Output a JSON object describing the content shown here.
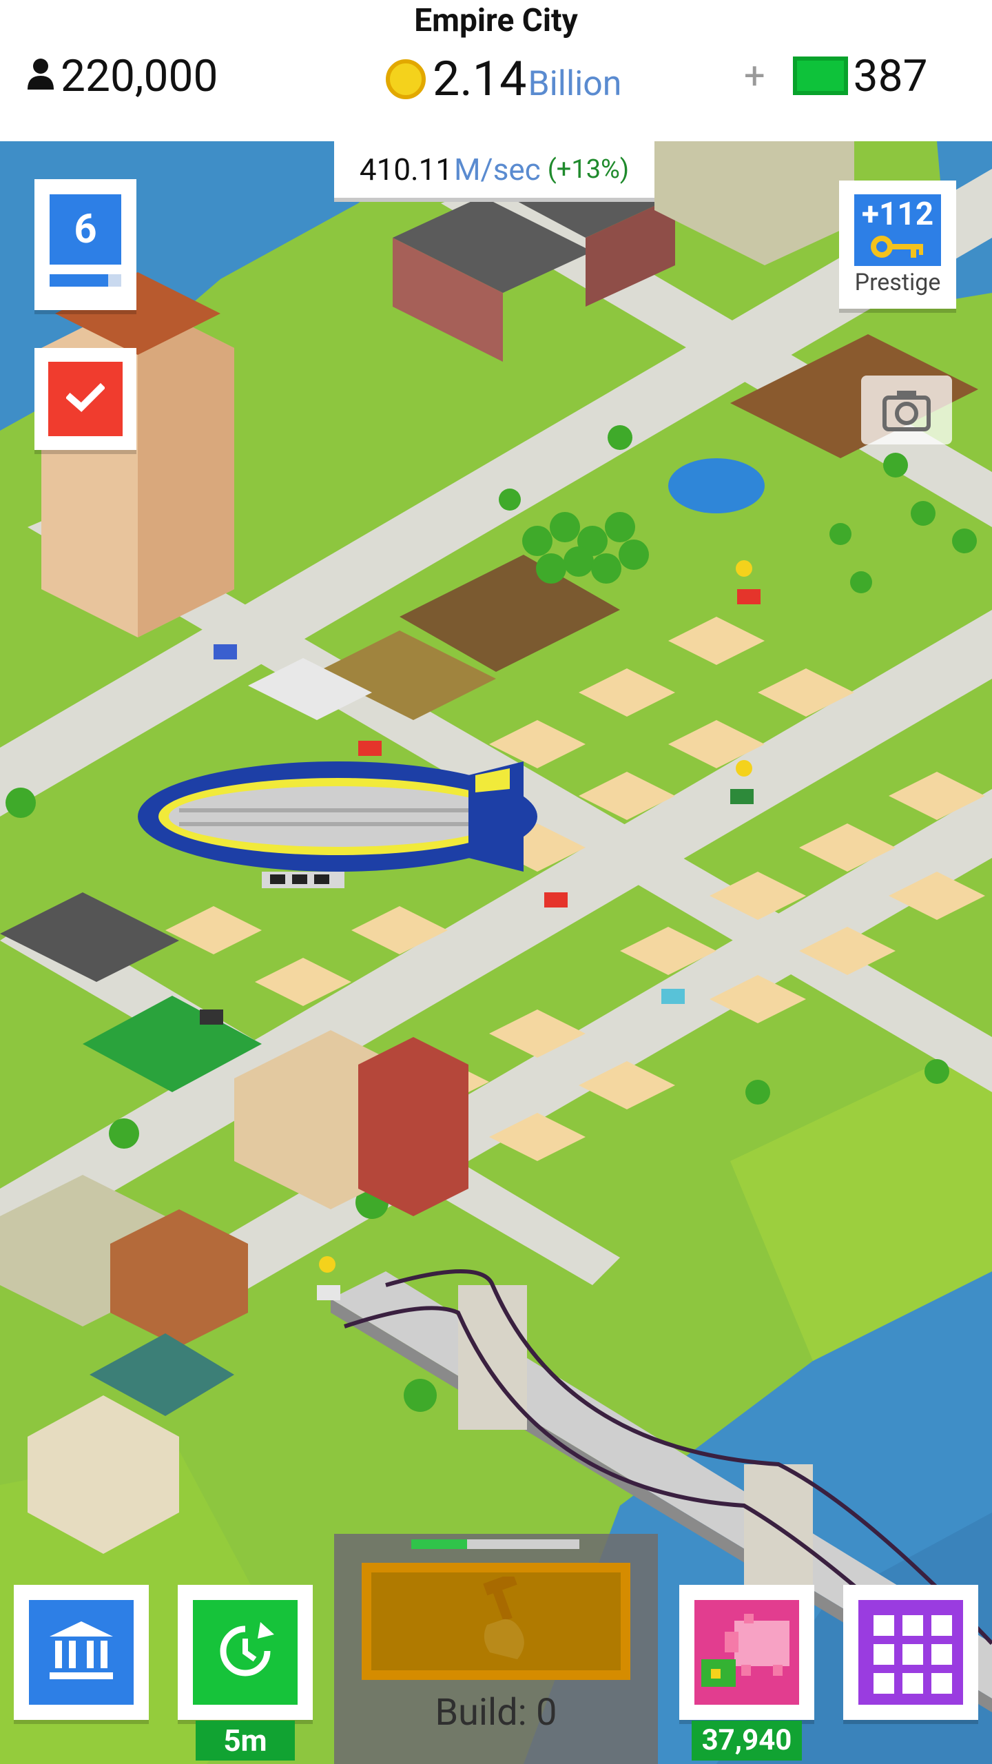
{
  "header": {
    "city_name": "Empire City",
    "population": "220,000",
    "coins_value": "2.14",
    "coins_unit": "Billion",
    "plus": "+",
    "cash": "387"
  },
  "income": {
    "amount": "410.11",
    "unit": "M/sec",
    "boost": "(+13%)"
  },
  "level": {
    "number": "6",
    "progress": 0.82
  },
  "prestige": {
    "amount": "+112",
    "label": "Prestige"
  },
  "bottom": {
    "timer_label": "5m",
    "piggy_label": "37,940",
    "build_label": "Build: 0",
    "build_progress": 0.33
  },
  "icons": {
    "population": "person-icon",
    "coin": "coin-icon",
    "cash": "cash-icon",
    "task": "checkmark-icon",
    "prestige": "key-icon",
    "camera": "camera-icon",
    "bank": "bank-icon",
    "time": "clock-icon",
    "piggy": "piggy-bank-icon",
    "menu": "grid-icon",
    "build": "hammer-icon"
  },
  "colors": {
    "blue": "#2d7fe6",
    "green": "#16c33a",
    "red": "#f03c2e",
    "purple": "#9a3ce0",
    "pink": "#e23d8f",
    "grass": "#8dc63f",
    "water": "#3f8ec7",
    "road": "#dcdcd4"
  }
}
